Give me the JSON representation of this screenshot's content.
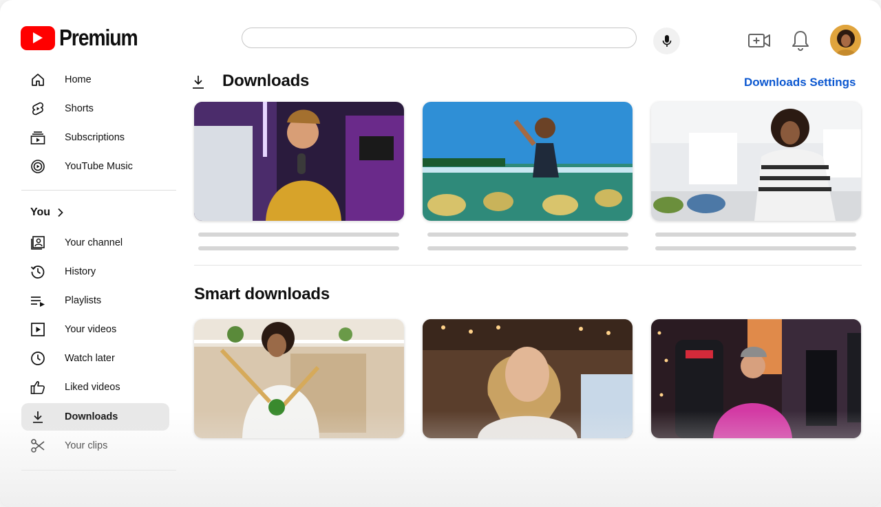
{
  "brand": {
    "name": "Premium"
  },
  "search": {
    "placeholder": ""
  },
  "sidebar": {
    "main": [
      {
        "label": "Home",
        "icon": "home-icon"
      },
      {
        "label": "Shorts",
        "icon": "shorts-icon"
      },
      {
        "label": "Subscriptions",
        "icon": "subscriptions-icon"
      },
      {
        "label": "YouTube Music",
        "icon": "music-icon"
      }
    ],
    "you_label": "You",
    "you_items": [
      {
        "label": "Your channel",
        "icon": "channel-icon"
      },
      {
        "label": "History",
        "icon": "history-icon"
      },
      {
        "label": "Playlists",
        "icon": "playlists-icon"
      },
      {
        "label": "Your videos",
        "icon": "your-videos-icon"
      },
      {
        "label": "Watch later",
        "icon": "watch-later-icon"
      },
      {
        "label": "Liked videos",
        "icon": "like-icon"
      },
      {
        "label": "Downloads",
        "icon": "download-icon",
        "active": true
      },
      {
        "label": "Your clips",
        "icon": "scissors-icon"
      }
    ]
  },
  "main": {
    "downloads_title": "Downloads",
    "downloads_settings": "Downloads Settings",
    "smart_title": "Smart downloads"
  },
  "colors": {
    "brand_red": "#ff0000",
    "link_blue": "#0b57d0",
    "active_bg": "#e8e8e8"
  }
}
